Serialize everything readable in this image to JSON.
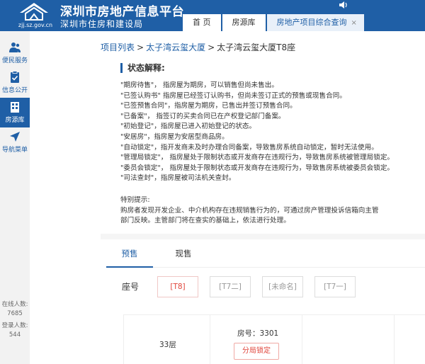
{
  "header": {
    "site_title": "深圳市房地产信息平台",
    "site_subtitle": "深圳市住房和建设局",
    "logo_url_text": "zjj.sz.gov.cn",
    "tabs": [
      {
        "label": "首 页"
      },
      {
        "label": "房源库"
      },
      {
        "label": "房地产项目综合查询",
        "close": "×"
      }
    ]
  },
  "sidebar": {
    "items": [
      {
        "label": "便民服务",
        "icon": "people-icon"
      },
      {
        "label": "信息公开",
        "icon": "checklist-icon"
      },
      {
        "label": "房源库",
        "icon": "building-icon"
      },
      {
        "label": "导航菜单",
        "icon": "navigation-icon"
      }
    ],
    "online_label": "在线人数:",
    "online_count": "7685",
    "login_label": "登录人数:",
    "login_count": "544"
  },
  "breadcrumb": {
    "items": [
      "项目列表",
      "太子湾云玺大厦",
      "太子湾云玺大厦T8座"
    ],
    "separator": ">"
  },
  "status": {
    "heading": "状态解释:",
    "lines": [
      "\"期房待售\"， 指房屋为期房，可以销售但尚未售出。",
      "\"已签认购书\" 指房屋已经签订认购书，但尚未签订正式的预售或现售合同。",
      "\"已签预售合同\"，指房屋为期房，已售出并签订预售合同。",
      "\"已备案\"， 指签订的买卖合同已在产权登记部门备案。",
      "\"初始登记\"，指房屋已进入初始登记的状态。",
      "\"安居房\"，指房屋为安居型商品房。",
      "\"自动锁定\"，指开发商未及时办理合同备案，导致售房系统自动锁定，暂时无法使用。",
      "\"管理局锁定\"， 指房屋处于限制状态或开发商存在违规行为，导致售房系统被管理局锁定。",
      "\"委员会锁定\"， 指房屋处于限制状态或开发商存在违规行为，导致售房系统被委员会锁定。",
      "\"司法查封\"，指房屋被司法机关查封。"
    ],
    "notice_title": "特别提示:",
    "notice_lines": [
      "购房者发现开发企业、中介机构存在违规销售行为的，可通过房产管理投诉信箱向主管",
      "部门反映。主管部门将在查实的基础上，依法进行处理。"
    ]
  },
  "sale_tabs": [
    {
      "label": "预售",
      "active": true
    },
    {
      "label": "现售",
      "active": false
    }
  ],
  "seats": {
    "label": "座号",
    "buttons": [
      {
        "label": "[T8]",
        "active": true
      },
      {
        "label": "[T7二]",
        "active": false
      },
      {
        "label": "[未命名]",
        "active": false
      },
      {
        "label": "[T7一]",
        "active": false
      }
    ]
  },
  "floor_table": {
    "floor": "33层",
    "room_no": "房号：3301",
    "room_status": "分局锁定"
  },
  "colors": {
    "brand_blue": "#1f5fa6",
    "lock_red": "#e0443a"
  }
}
